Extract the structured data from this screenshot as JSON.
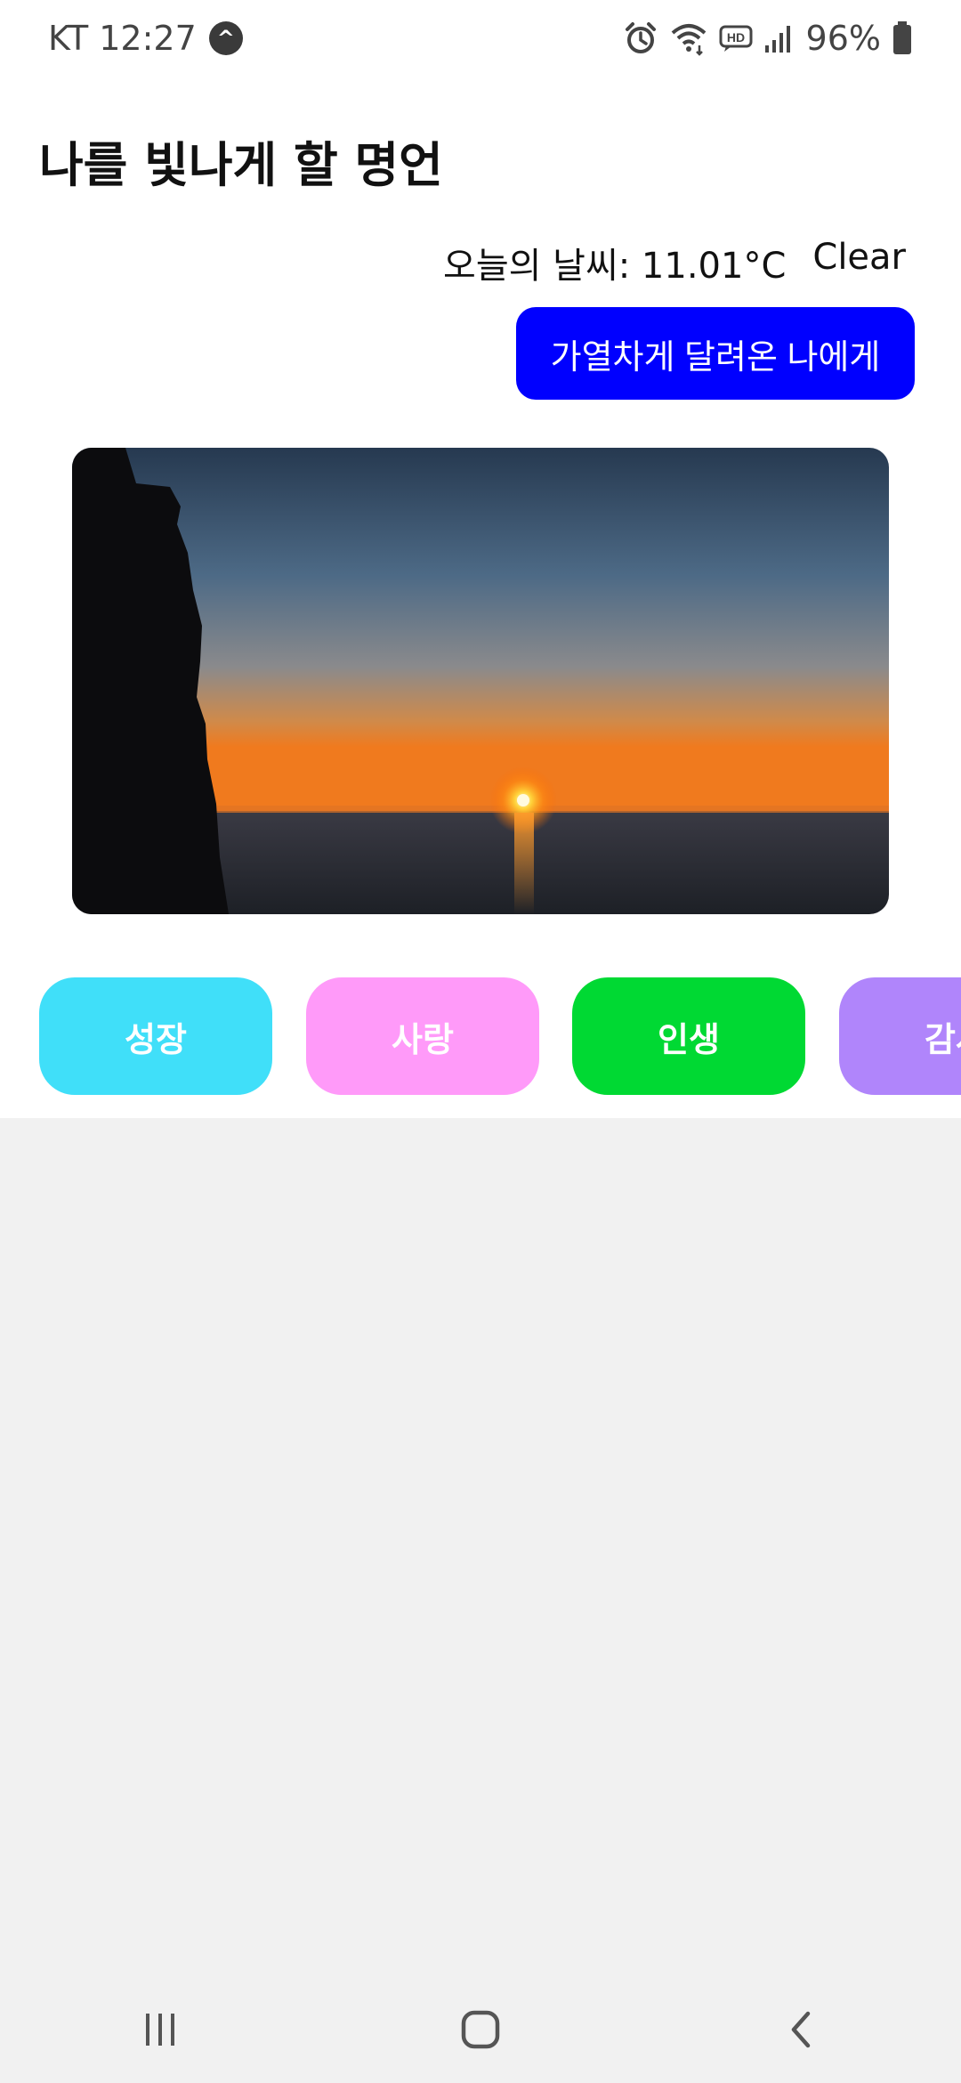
{
  "status_bar": {
    "carrier_time": "KT 12:27",
    "notification_glyph": "^",
    "battery": "96%",
    "icons": [
      "alarm-icon",
      "wifi-icon",
      "hd-voice-icon",
      "signal-icon",
      "battery-icon"
    ]
  },
  "header": {
    "title": "나를 빛나게 할 명언"
  },
  "weather": {
    "label": "오늘의 날씨: 11.01°C",
    "condition": "Clear"
  },
  "cta": {
    "label": "가열차게 달려온 나에게"
  },
  "categories": [
    {
      "label": "성장",
      "color": "#40dff9"
    },
    {
      "label": "사랑",
      "color": "#ff9af9"
    },
    {
      "label": "인생",
      "color": "#00d933"
    },
    {
      "label": "감사",
      "color": "#b085fb"
    }
  ],
  "colors": {
    "cta_background": "#0000ff",
    "content_background": "#ffffff",
    "page_background": "#f1f1f1"
  },
  "nav_bar": {
    "icons": [
      "recent-apps-icon",
      "home-icon",
      "back-icon"
    ]
  }
}
